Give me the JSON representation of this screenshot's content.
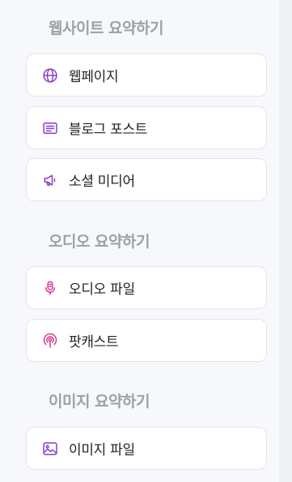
{
  "sections": [
    {
      "title": "웹사이트 요약하기",
      "items": [
        {
          "label": "웹페이지",
          "icon": "globe-icon",
          "color": "#8b3fc9"
        },
        {
          "label": "블로그 포스트",
          "icon": "document-lines-icon",
          "color": "#8b3fc9"
        },
        {
          "label": "소셜 미디어",
          "icon": "megaphone-icon",
          "color": "#8b3fc9"
        }
      ]
    },
    {
      "title": "오디오 요약하기",
      "items": [
        {
          "label": "오디오 파일",
          "icon": "microphone-icon",
          "color": "#d43f8d"
        },
        {
          "label": "팟캐스트",
          "icon": "podcast-icon",
          "color": "#d43f8d"
        }
      ]
    },
    {
      "title": "이미지 요약하기",
      "items": [
        {
          "label": "이미지 파일",
          "icon": "image-icon",
          "color": "#7b46c9"
        }
      ]
    }
  ]
}
